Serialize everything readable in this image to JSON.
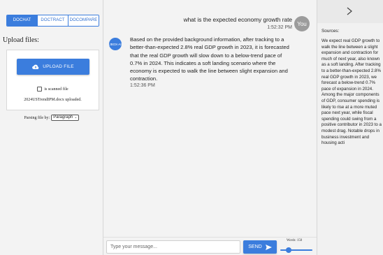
{
  "tabs": [
    {
      "label": "DOCHAT",
      "active": true
    },
    {
      "label": "DOCTRACT",
      "active": false
    },
    {
      "label": "DOCOMPARE",
      "active": false
    }
  ],
  "upload": {
    "title": "Upload files:",
    "button_label": "UPLOAD FILE",
    "button_icon": "cloud-upload-icon",
    "scanned_label": "is scanned file",
    "scanned_checked": false,
    "uploaded_text": "2024USTrendIPM.docx uploaded."
  },
  "parsing": {
    "label": "Parsing file by:",
    "selected": "Paragraph"
  },
  "chat": {
    "user_message": {
      "text": "what is the expected economy growth rate",
      "time": "1:52:32 PM",
      "avatar": "You"
    },
    "bot_message": {
      "avatar": "JBOX-AI",
      "text": "Based on the provided background information, after tracking to a better-than-expected 2.8% real GDP growth in 2023, it is forecasted that the real GDP growth will slow down to a below-trend pace of 0.7% in 2024. This indicates a soft landing scenario where the economy is expected to walk the line between slight expansion and contraction.",
      "time": "1:52:36 PM"
    }
  },
  "input": {
    "placeholder": "Type your message...",
    "send_label": "SEND",
    "words_label": "Words: 150",
    "words_value": 150
  },
  "sources": {
    "title": "Sources:",
    "text": "We expect real GDP growth to walk the line between a slight expansion and contraction for much of next year, also known as a soft landing. After tracking to a better-than-expected 2.8% real GDP growth in 2023, we forecast a below-trend 0.7% pace of expansion in 2024. Among the major components of GDP, consumer spending is likely to rise at a more muted pace next year, while fiscal spending could swing from a positive contributor in 2023 to a modest drag. Notable drops in business investment and housing acti"
  },
  "colors": {
    "accent": "#3b7ddd",
    "panel_bg": "#f3f3f3",
    "user_avatar": "#9c9c9c"
  }
}
